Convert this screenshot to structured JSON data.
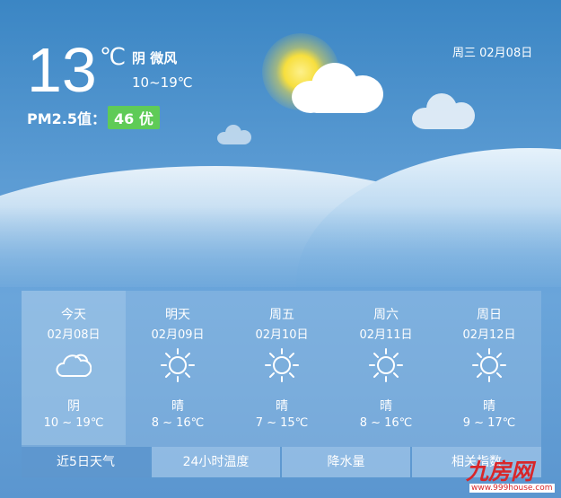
{
  "current": {
    "temperature": "13",
    "unit": "℃",
    "condition": "阴 微风",
    "range": "10~19℃",
    "pm_label": "PM2.5值：",
    "aqi": "46 优",
    "date": "周三 02月08日"
  },
  "forecast": [
    {
      "name": "今天",
      "date": "02月08日",
      "icon": "cloud-icon",
      "weather": "阴",
      "range": "10 ~ 19℃"
    },
    {
      "name": "明天",
      "date": "02月09日",
      "icon": "sun-icon",
      "weather": "晴",
      "range": "8 ~ 16℃"
    },
    {
      "name": "周五",
      "date": "02月10日",
      "icon": "sun-icon",
      "weather": "晴",
      "range": "7 ~ 15℃"
    },
    {
      "name": "周六",
      "date": "02月11日",
      "icon": "sun-icon",
      "weather": "晴",
      "range": "8 ~ 16℃"
    },
    {
      "name": "周日",
      "date": "02月12日",
      "icon": "sun-icon",
      "weather": "晴",
      "range": "9 ~ 17℃"
    }
  ],
  "tabs": [
    {
      "label": "近5日天气"
    },
    {
      "label": "24小时温度"
    },
    {
      "label": "降水量"
    },
    {
      "label": "相关指数"
    }
  ],
  "watermark": {
    "text": "九房网",
    "url": "www.999house.com"
  },
  "colors": {
    "aqi_good": "#5fcb57",
    "sky": "#3b86c4"
  }
}
